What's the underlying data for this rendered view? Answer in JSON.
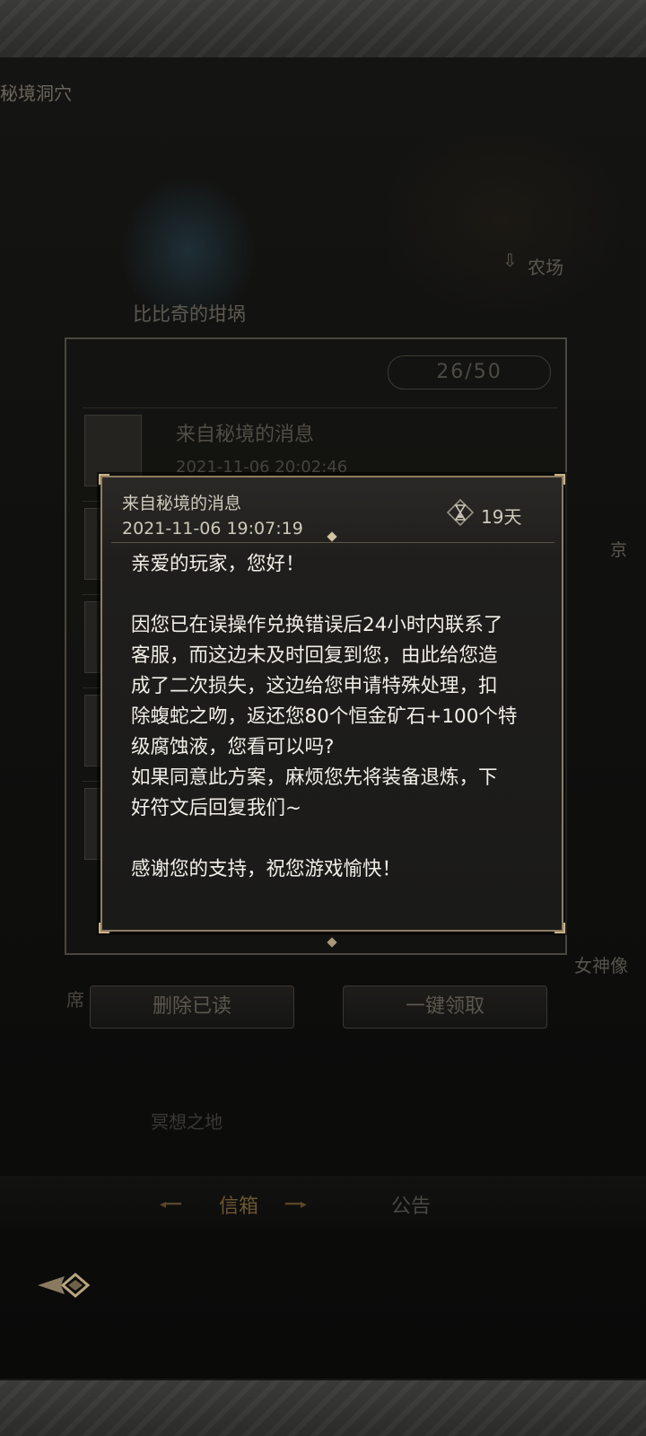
{
  "background": {
    "area_title": "秘境洞穴",
    "farm_label": "农场",
    "bibiqi_label": "比比奇的坩埚",
    "goddess_label": "女神像",
    "side_fragment": "京",
    "seat_fragment": "席",
    "meditation_label": "冥想之地"
  },
  "mailbox": {
    "count": "26/50",
    "list_title": "来自秘境的消息",
    "list_time": "2021-11-06 20:02:46",
    "delete_read_label": "删除已读",
    "claim_all_label": "一键领取"
  },
  "tabs": {
    "mail": "信箱",
    "notice": "公告"
  },
  "message": {
    "title": "来自秘境的消息",
    "timestamp": "2021-11-06 19:07:19",
    "days_left": "19天",
    "body": "亲爱的玩家，您好！\n\n因您已在误操作兑换错误后24小时内联系了\n客服，而这边未及时回复到您，由此给您造\n成了二次损失，这边给您申请特殊处理，扣\n除蝮蛇之吻，返还您80个恒金矿石+100个特\n级腐蚀液，您看可以吗?\n如果同意此方案，麻烦您先将装备退炼，下\n好符文后回复我们~\n\n感谢您的支持，祝您游戏愉快！"
  },
  "icons": {
    "hourglass": "hourglass-icon",
    "back": "back-arrow-icon",
    "farm": "down-arrow-icon"
  },
  "colors": {
    "dialog_border": "#8f7d60",
    "text_primary": "#f2efe8",
    "tab_active": "#6b5632"
  }
}
